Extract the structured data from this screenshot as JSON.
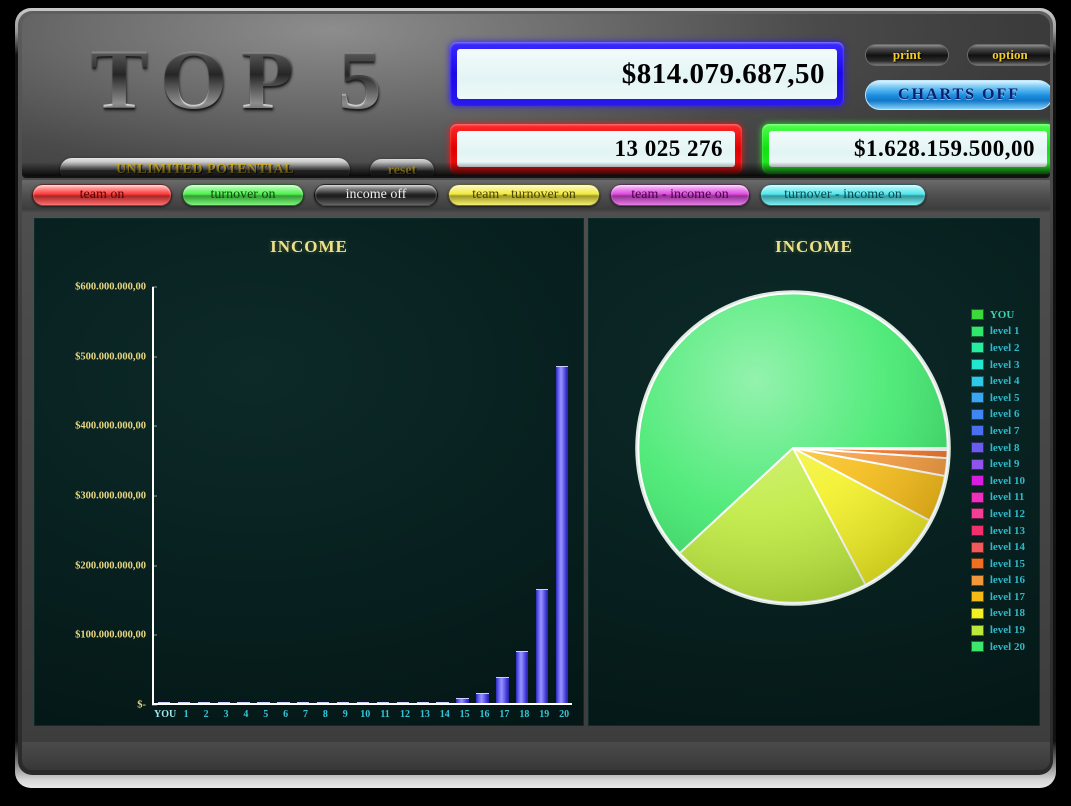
{
  "app": {
    "logo_text": "TOP 5",
    "slogan": "UNLIMITED POTENTIAL",
    "reset_label": "reset"
  },
  "header": {
    "print_label": "print",
    "option_label": "option",
    "charts_toggle_label": "CHARTS  OFF",
    "total_income_value": "$814.079.687,50",
    "members_value": "13 025 276",
    "turnover_value": "$1.628.159.500,00"
  },
  "tabs": [
    {
      "label": "team on",
      "color": "#ff3b3b",
      "text": "#5a0000"
    },
    {
      "label": "turnover on",
      "color": "#4ef24e",
      "text": "#0a4a0a"
    },
    {
      "label": "income off",
      "color": "#2a2a2a",
      "text": "#f0f0f0"
    },
    {
      "label": "team - turnover on",
      "color": "#f2ea3c",
      "text": "#4a4400"
    },
    {
      "label": "team - income on",
      "color": "#e04be0",
      "text": "#4a004a"
    },
    {
      "label": "turnover - income on",
      "color": "#4fe8ee",
      "text": "#054a4e"
    }
  ],
  "chart_data": [
    {
      "type": "bar",
      "title": "INCOME",
      "xlabel": "",
      "ylabel": "",
      "ylim": [
        0,
        600000000
      ],
      "ytick_labels": [
        "$600.000.000,00",
        "$500.000.000,00",
        "$400.000.000,00",
        "$300.000.000,00",
        "$200.000.000,00",
        "$100.000.000,00",
        "$-"
      ],
      "ytick_values": [
        600000000,
        500000000,
        400000000,
        300000000,
        200000000,
        100000000,
        0
      ],
      "categories": [
        "YOU",
        "1",
        "2",
        "3",
        "4",
        "5",
        "6",
        "7",
        "8",
        "9",
        "10",
        "11",
        "12",
        "13",
        "14",
        "15",
        "16",
        "17",
        "18",
        "19",
        "20"
      ],
      "values": [
        0,
        0,
        0,
        0,
        0,
        0,
        0,
        0,
        0,
        0,
        0,
        0,
        0,
        250000,
        1500000,
        6500000,
        14500000,
        38000000,
        74000000,
        163000000,
        484000000
      ],
      "bar_color": "#6a63f2",
      "grid": false,
      "legend": "none"
    },
    {
      "type": "pie",
      "title": "INCOME",
      "legend_position": "right",
      "labels": [
        "YOU",
        "level 1",
        "level 2",
        "level 3",
        "level 4",
        "level 5",
        "level 6",
        "level 7",
        "level 8",
        "level 9",
        "level 10",
        "level 11",
        "level 12",
        "level 13",
        "level 14",
        "level 15",
        "level 16",
        "level 17",
        "level 18",
        "level 19",
        "level 20"
      ],
      "values": [
        0,
        0,
        0,
        0,
        0,
        0,
        0,
        0,
        0,
        0,
        0,
        0,
        0,
        0.03,
        0.18,
        0.8,
        1.78,
        4.67,
        9.09,
        20.02,
        59.43
      ],
      "colors": [
        "#3bd93b",
        "#30e86b",
        "#27eda0",
        "#23e6cf",
        "#2fc9e8",
        "#3aa6f0",
        "#3f86f2",
        "#4a6ef0",
        "#6a5ced",
        "#8f54ea",
        "#d81ce0",
        "#ef2fbe",
        "#f53f96",
        "#f2306b",
        "#f05a5a",
        "#ef7020",
        "#f2983a",
        "#f5bb12",
        "#f2f020",
        "#bdea3a",
        "#3ce86a"
      ]
    }
  ]
}
